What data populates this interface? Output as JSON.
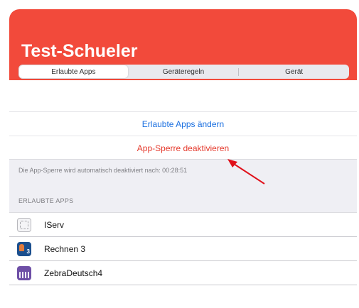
{
  "header": {
    "title": "Test-Schueler",
    "background_color": "#f24a3b"
  },
  "tabs": [
    {
      "label": "Erlaubte Apps",
      "active": true
    },
    {
      "label": "Geräteregeln",
      "active": false
    },
    {
      "label": "Gerät",
      "active": false
    }
  ],
  "actions": {
    "change_apps": "Erlaubte Apps ändern",
    "disable_lock": "App-Sperre deaktivieren",
    "change_apps_color": "#1a6fe0",
    "disable_lock_color": "#e53b2e"
  },
  "note": "Die App-Sperre wird automatisch deaktiviert nach: 00:28:51",
  "apps_section": {
    "heading": "ERLAUBTE APPS",
    "items": [
      {
        "name": "IServ",
        "icon": "iserv-app-icon"
      },
      {
        "name": "Rechnen 3",
        "icon": "rechnen-3-app-icon",
        "icon_badge": "3"
      },
      {
        "name": "ZebraDeutsch4",
        "icon": "zebradeutsch-app-icon"
      }
    ]
  },
  "annotation": {
    "icon": "red-arrow-icon",
    "color": "#e0101a"
  }
}
